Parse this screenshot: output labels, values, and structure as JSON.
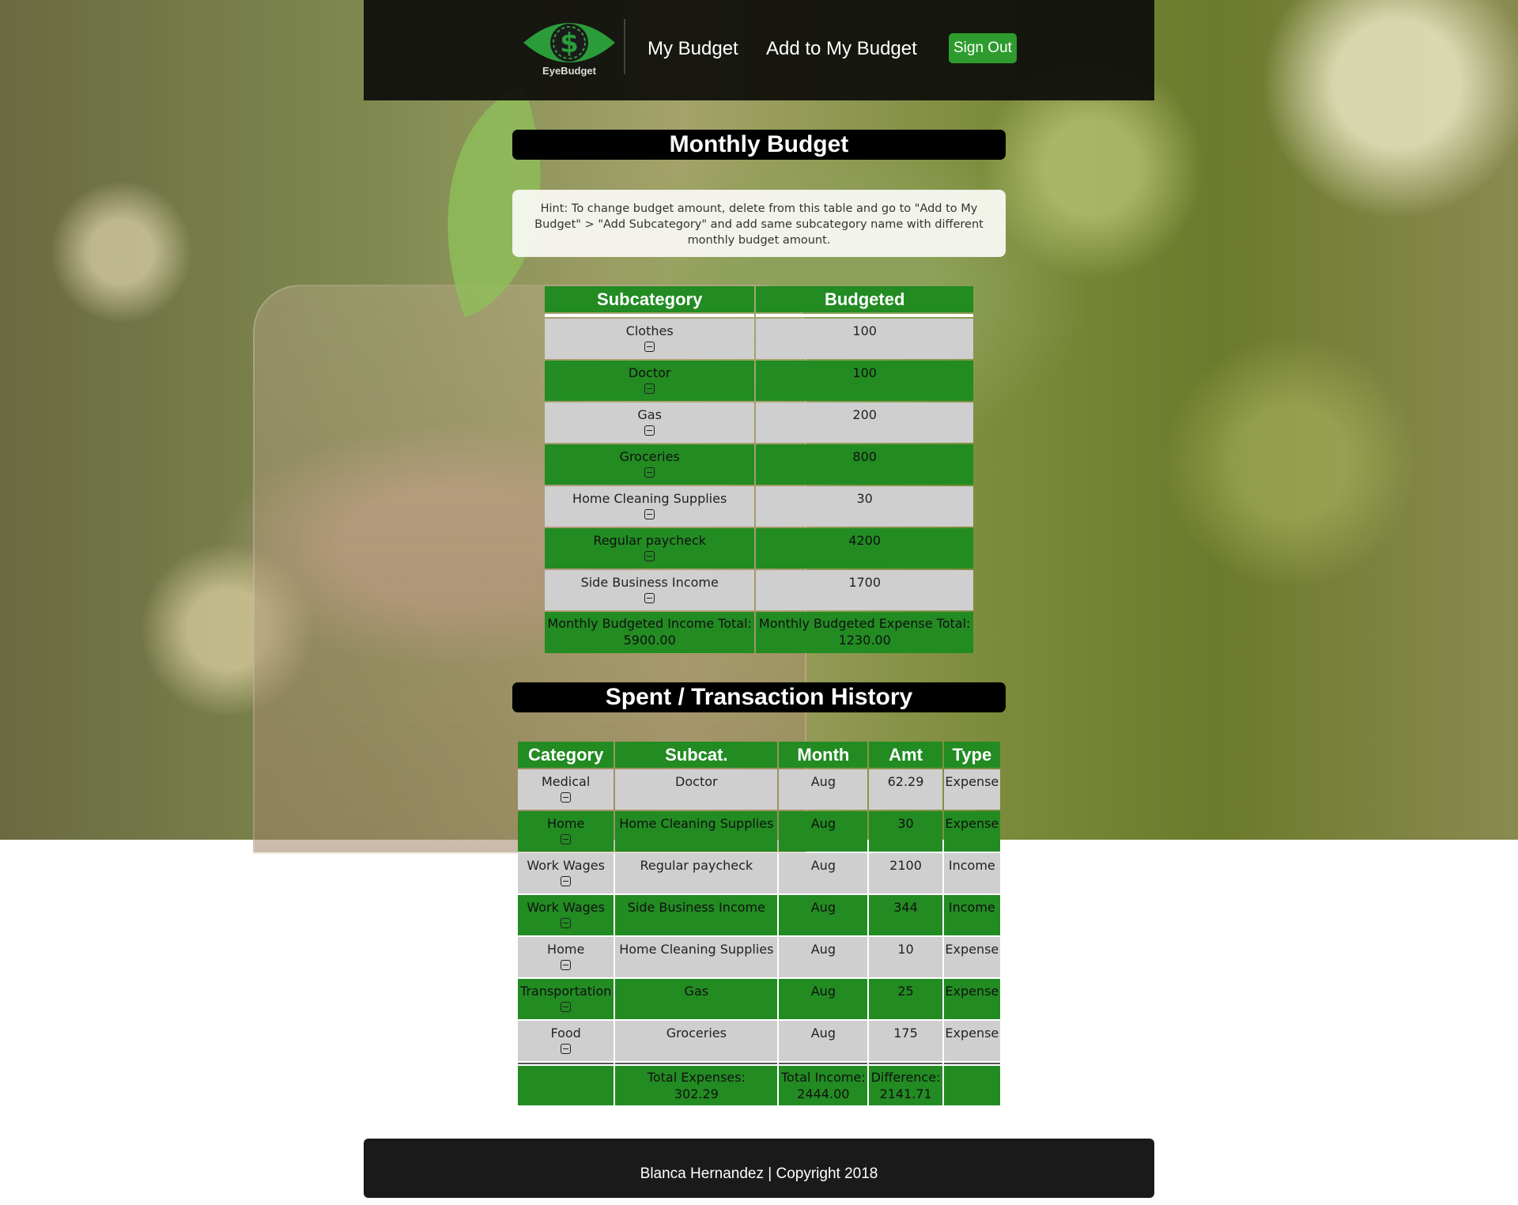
{
  "header": {
    "logo_text": "EyeBudget",
    "nav": {
      "my_budget": "My Budget",
      "add_budget": "Add to My Budget"
    },
    "sign_out": "Sign Out"
  },
  "budget": {
    "title": "Monthly Budget",
    "hint": "Hint: To change budget amount, delete from this table and go to \"Add to My Budget\" > \"Add Subcategory\" and add same subcategory name with different monthly budget amount.",
    "columns": [
      "Subcategory",
      "Budgeted"
    ],
    "rows": [
      {
        "subcategory": "Clothes",
        "budgeted": "100"
      },
      {
        "subcategory": "Doctor",
        "budgeted": "100"
      },
      {
        "subcategory": "Gas",
        "budgeted": "200"
      },
      {
        "subcategory": "Groceries",
        "budgeted": "800"
      },
      {
        "subcategory": "Home Cleaning Supplies",
        "budgeted": "30"
      },
      {
        "subcategory": "Regular paycheck",
        "budgeted": "4200"
      },
      {
        "subcategory": "Side Business Income",
        "budgeted": "1700"
      }
    ],
    "income_total_label": "Monthly Budgeted Income Total:",
    "income_total": "5900.00",
    "expense_total_label": "Monthly Budgeted Expense Total:",
    "expense_total": "1230.00"
  },
  "history": {
    "title": "Spent / Transaction History",
    "columns": [
      "Category",
      "Subcat.",
      "Month",
      "Amt",
      "Type"
    ],
    "rows": [
      {
        "category": "Medical",
        "subcat": "Doctor",
        "month": "Aug",
        "amt": "62.29",
        "type": "Expense"
      },
      {
        "category": "Home",
        "subcat": "Home Cleaning Supplies",
        "month": "Aug",
        "amt": "30",
        "type": "Expense"
      },
      {
        "category": "Work Wages",
        "subcat": "Regular paycheck",
        "month": "Aug",
        "amt": "2100",
        "type": "Income"
      },
      {
        "category": "Work Wages",
        "subcat": "Side Business Income",
        "month": "Aug",
        "amt": "344",
        "type": "Income"
      },
      {
        "category": "Home",
        "subcat": "Home Cleaning Supplies",
        "month": "Aug",
        "amt": "10",
        "type": "Expense"
      },
      {
        "category": "Transportation",
        "subcat": "Gas",
        "month": "Aug",
        "amt": "25",
        "type": "Expense"
      },
      {
        "category": "Food",
        "subcat": "Groceries",
        "month": "Aug",
        "amt": "175",
        "type": "Expense"
      }
    ],
    "total_expenses_label": "Total Expenses:",
    "total_expenses": "302.29",
    "total_income_label": "Total Income:",
    "total_income": "2444.00",
    "difference_label": "Difference:",
    "difference": "2141.71"
  },
  "footer": {
    "text": "Blanca Hernandez | Copyright 2018"
  },
  "colors": {
    "accent": "#228b22",
    "row_light": "#cfcfcf",
    "header_bg": "#0c0c0a"
  }
}
